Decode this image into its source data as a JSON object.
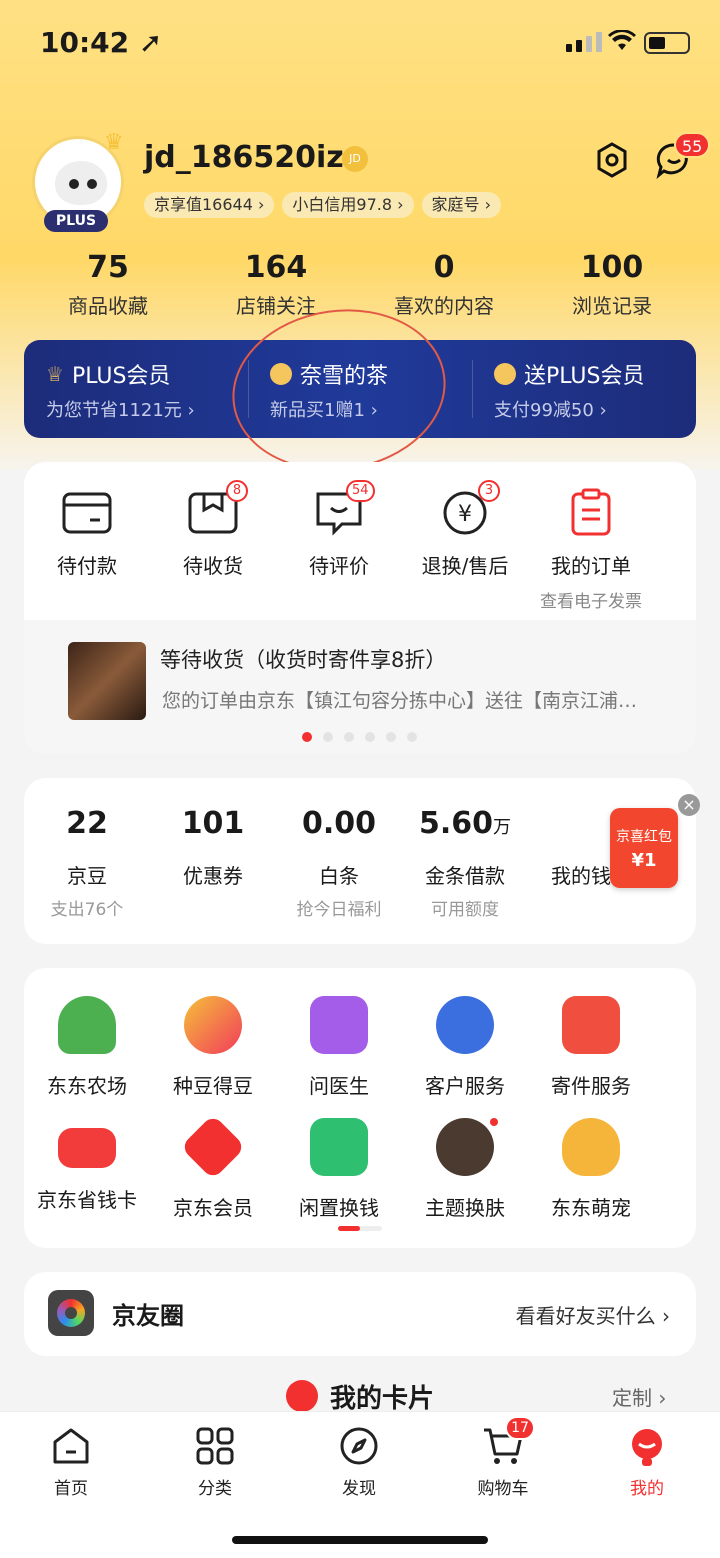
{
  "status_bar": {
    "time": "10:42 ➚"
  },
  "profile": {
    "username": "jd_186520ize",
    "plus_badge": "PLUS",
    "jd_badge": "JD",
    "tags": [
      "京享值16644 ›",
      "小白信用97.8 ›",
      "家庭号 ›"
    ],
    "message_count": "55"
  },
  "stats": [
    {
      "num": "75",
      "label": "商品收藏"
    },
    {
      "num": "164",
      "label": "店铺关注"
    },
    {
      "num": "0",
      "label": "喜欢的内容"
    },
    {
      "num": "100",
      "label": "浏览记录"
    }
  ],
  "plus_bar": [
    {
      "title": "PLUS会员",
      "sub": "为您节省1121元 ›"
    },
    {
      "title": "奈雪的茶",
      "sub": "新品买1赠1 ›"
    },
    {
      "title": "送PLUS会员",
      "sub": "支付99减50 ›"
    }
  ],
  "orders": {
    "items": [
      {
        "label": "待付款",
        "badge": ""
      },
      {
        "label": "待收货",
        "badge": "8"
      },
      {
        "label": "待评价",
        "badge": "54"
      },
      {
        "label": "退换/售后",
        "badge": "3"
      },
      {
        "label": "我的订单",
        "sub": "查看电子发票"
      }
    ],
    "shipping": {
      "title": "等待收货（收货时寄件享8折）",
      "desc": "您的订单由京东【镇江句容分拣中心】送往【南京江浦…"
    }
  },
  "wallet": {
    "items": [
      {
        "num": "22",
        "unit": "",
        "label": "京豆",
        "sub": "支出76个"
      },
      {
        "num": "101",
        "unit": "",
        "label": "优惠券",
        "sub": ""
      },
      {
        "num": "0.00",
        "unit": "",
        "label": "白条",
        "sub": "抢今日福利"
      },
      {
        "num": "5.60",
        "unit": "万",
        "label": "金条借款",
        "sub": "可用额度"
      },
      {
        "num": "",
        "unit": "",
        "label": "我的钱包",
        "sub": ""
      }
    ],
    "redpack": {
      "title": "京喜红包",
      "amount": "¥1"
    }
  },
  "tools": [
    {
      "label": "东东农场",
      "color": "#4caf50"
    },
    {
      "label": "种豆得豆",
      "color": "#f25a3a"
    },
    {
      "label": "问医生",
      "color": "#a45de8"
    },
    {
      "label": "客户服务",
      "color": "#3b6fe0"
    },
    {
      "label": "寄件服务",
      "color": "#f04e3e"
    },
    {
      "label": "京东省钱卡",
      "color": "#f23b3b"
    },
    {
      "label": "京东会员",
      "color": "#f23030"
    },
    {
      "label": "闲置换钱",
      "color": "#2fbf71"
    },
    {
      "label": "主题换肤",
      "color": "#4a3a30"
    },
    {
      "label": "东东萌宠",
      "color": "#f5b53b"
    }
  ],
  "friends": {
    "title": "京友圈",
    "link": "看看好友买什么 ›"
  },
  "my_cards": {
    "title": "我的卡片",
    "link": "定制 ›"
  },
  "tabbar": {
    "items": [
      {
        "label": "首页"
      },
      {
        "label": "分类"
      },
      {
        "label": "发现"
      },
      {
        "label": "购物车",
        "badge": "17"
      },
      {
        "label": "我的"
      }
    ]
  }
}
